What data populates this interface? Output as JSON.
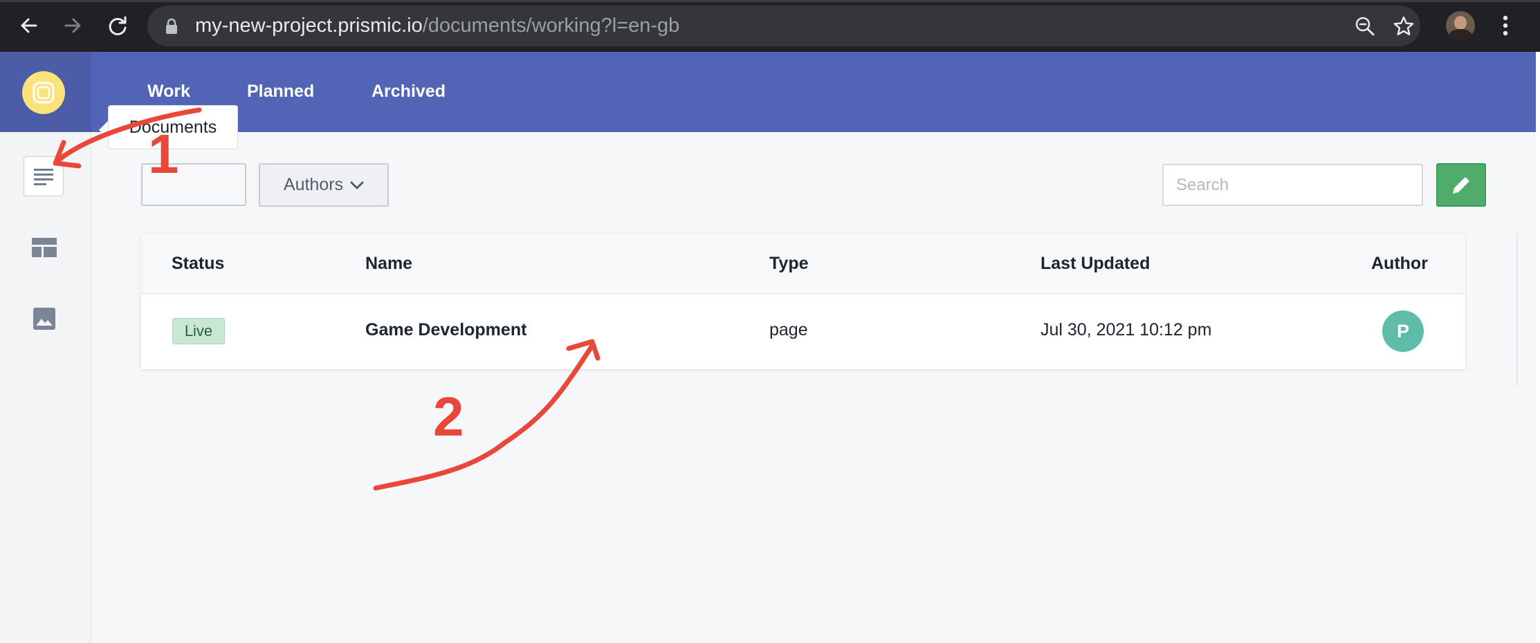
{
  "browser": {
    "url_host": "my-new-project.prismic.io",
    "url_path": "/documents/working?l=en-gb",
    "icons": [
      "back-arrow-icon",
      "forward-arrow-icon",
      "reload-icon",
      "lock-icon",
      "zoom-icon",
      "star-icon",
      "profile-avatar",
      "menu-dots-icon"
    ]
  },
  "header": {
    "tabs": [
      {
        "label": "Work",
        "active": true
      },
      {
        "label": "Planned",
        "active": false
      },
      {
        "label": "Archived",
        "active": false
      }
    ],
    "color": "#5164b5"
  },
  "sidebar": {
    "items": [
      {
        "icon": "documents-icon",
        "tooltip": "Documents",
        "active": true
      },
      {
        "icon": "custom-types-icon"
      },
      {
        "icon": "media-icon"
      }
    ]
  },
  "filters": {
    "authors_label": "Authors",
    "search_placeholder": "Search"
  },
  "table": {
    "headers": {
      "status": "Status",
      "name": "Name",
      "type": "Type",
      "last_updated": "Last Updated",
      "author": "Author"
    },
    "rows": [
      {
        "status": "Live",
        "name": "Game Development",
        "type": "page",
        "last_updated": "Jul 30, 2021 10:12 pm",
        "author_initial": "P"
      }
    ]
  },
  "annotations": {
    "first": "1",
    "second": "2",
    "color": "#e8473a"
  }
}
